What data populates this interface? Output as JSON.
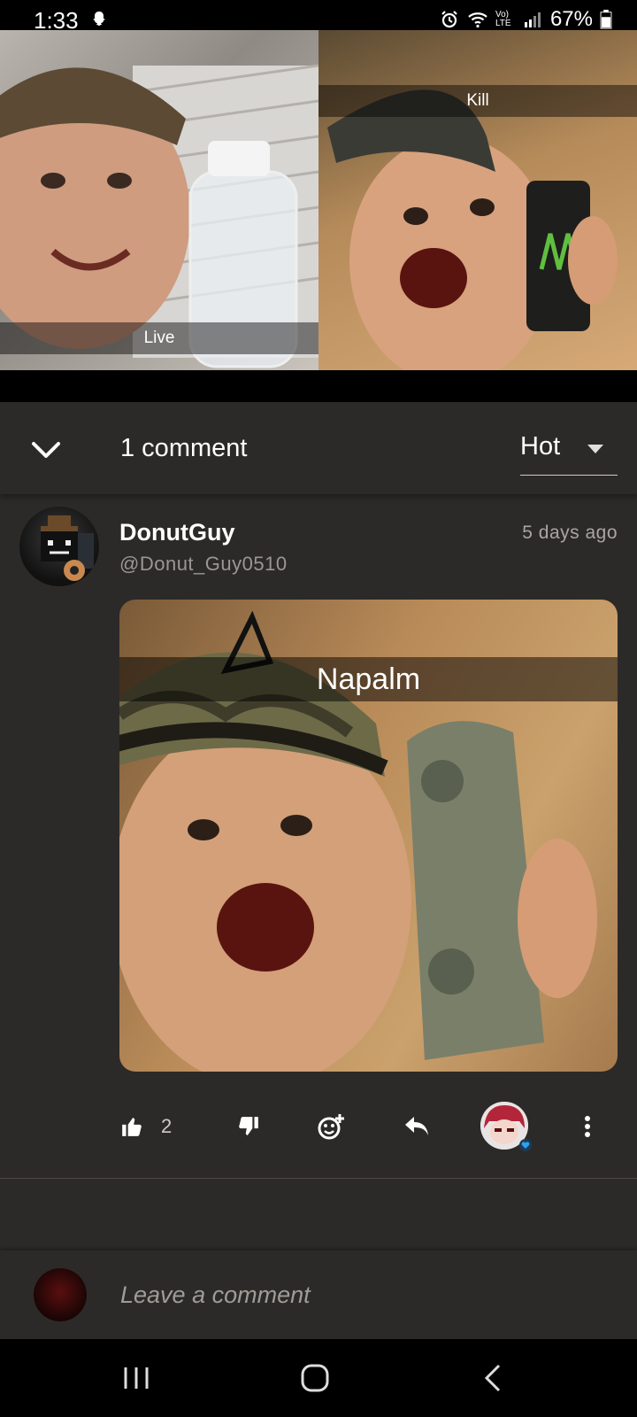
{
  "status_bar": {
    "time": "1:33",
    "signal_label": "Vo) LTE",
    "battery": "67%"
  },
  "media": {
    "left_caption": "Live",
    "right_caption": "Kill"
  },
  "comments_header": {
    "count_label": "1 comment",
    "sort_value": "Hot"
  },
  "comment": {
    "author": "DonutGuy",
    "handle": "@Donut_Guy0510",
    "timestamp": "5 days ago",
    "image_caption": "Napalm",
    "like_count": "2"
  },
  "compose": {
    "placeholder": "Leave a comment"
  },
  "colors": {
    "background": "#2c2a28",
    "reaction_heart": "#2aa3f0"
  }
}
